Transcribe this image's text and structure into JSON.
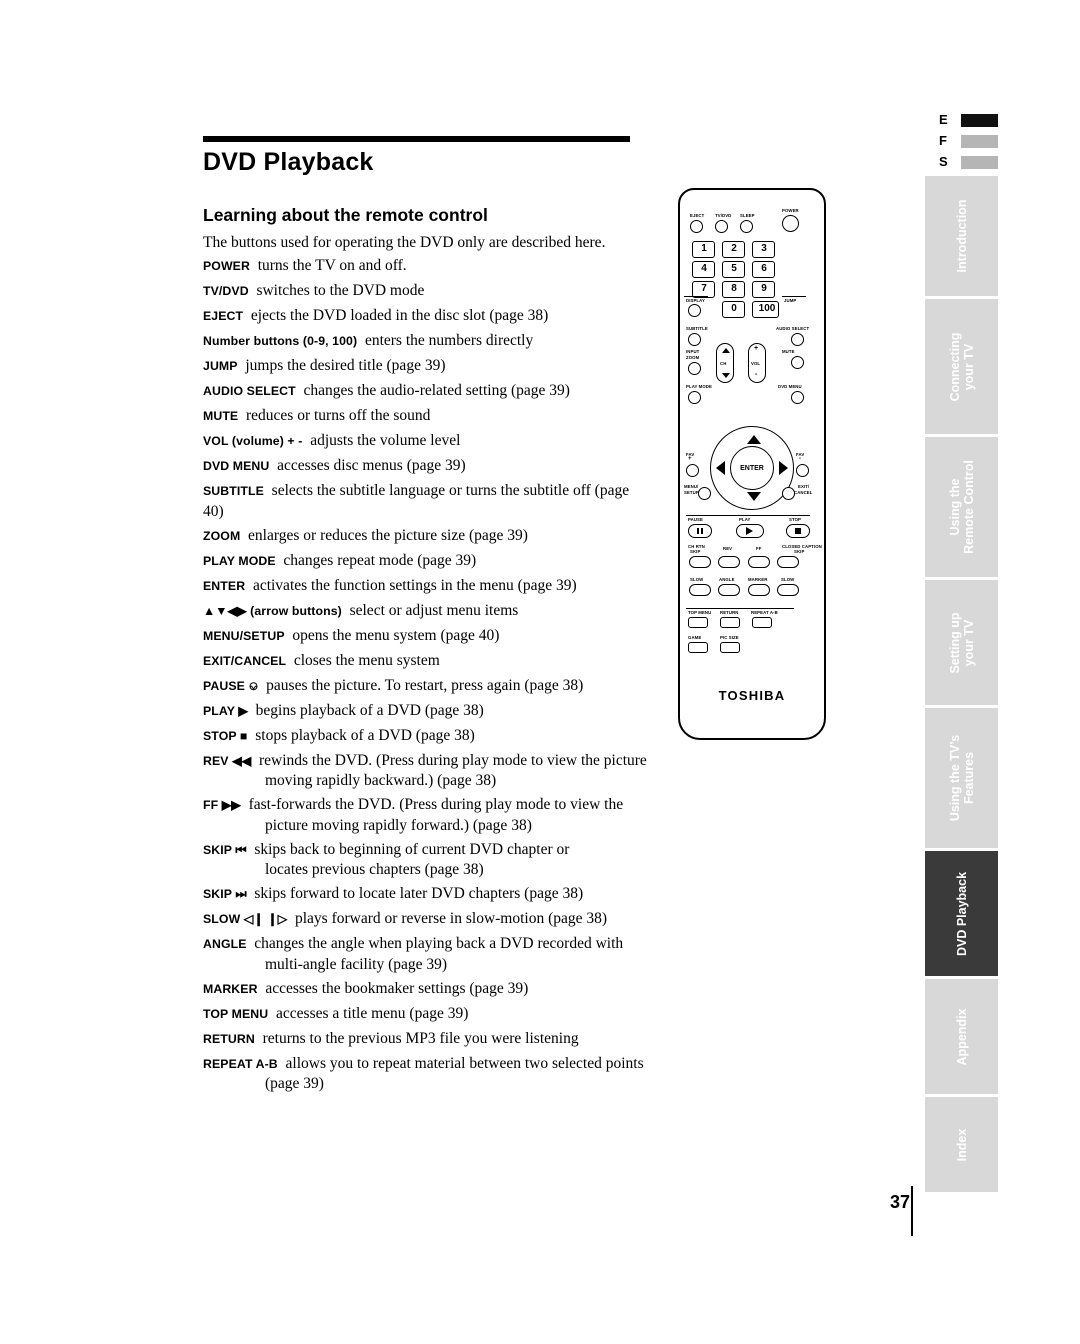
{
  "page": {
    "title": "DVD Playback",
    "section": "Learning about the remote control",
    "intro": "The buttons used for operating the DVD only are described here.",
    "number": "37"
  },
  "definitions": [
    {
      "key": "POWER",
      "text": "turns the TV on and off."
    },
    {
      "key": "TV/DVD",
      "text": "switches to the DVD mode"
    },
    {
      "key": "EJECT",
      "text": "ejects the DVD loaded in the disc slot (page 38)"
    },
    {
      "key": "Number buttons (0-9, 100)",
      "text": "enters the numbers directly",
      "keyonly": true
    },
    {
      "key": "JUMP",
      "text": "jumps the desired title (page 39)"
    },
    {
      "key": "AUDIO SELECT",
      "text": "changes the audio-related setting (page 39)"
    },
    {
      "key": "MUTE",
      "text": "reduces or turns off the sound"
    },
    {
      "key": "VOL (volume) + -",
      "text": "adjusts the volume level"
    },
    {
      "key": "DVD MENU",
      "text": "accesses disc menus (page 39)"
    },
    {
      "key": "SUBTITLE",
      "text": "selects the subtitle language or turns the subtitle off (page 40)"
    },
    {
      "key": "ZOOM",
      "text": "enlarges or reduces the picture size (page 39)"
    },
    {
      "key": "PLAY MODE",
      "text": "changes repeat mode (page 39)"
    },
    {
      "key": "ENTER",
      "text": "activates the function settings in the menu (page 39)"
    },
    {
      "key": "▲▼◀▶ (arrow buttons)",
      "text": "select or adjust menu items"
    },
    {
      "key": "MENU/SETUP",
      "text": "opens the menu system (page 40)"
    },
    {
      "key": "EXIT/CANCEL",
      "text": "closes the menu system"
    },
    {
      "key": "PAUSE ⎉",
      "text": "pauses the picture. To restart, press again (page 38)"
    },
    {
      "key": "PLAY ▶",
      "text": "begins playback of a DVD (page 38)"
    },
    {
      "key": "STOP ■",
      "text": "stops playback of a DVD (page 38)"
    },
    {
      "key": "REV ◀◀",
      "text": "rewinds the DVD. (Press during play mode to view the picture",
      "cont": "moving rapidly backward.) (page 38)"
    },
    {
      "key": "FF ▶▶",
      "text": "fast-forwards the DVD. (Press during play mode to view the",
      "cont": "picture moving rapidly forward.) (page 38)"
    },
    {
      "key": "SKIP ⏮",
      "text": "skips back to beginning of current DVD chapter or",
      "cont": "locates previous chapters (page 38)"
    },
    {
      "key": "SKIP ⏭",
      "text": "skips forward to locate later DVD chapters (page 38)"
    },
    {
      "key": "SLOW ◁❙ ❙▷",
      "text": "plays forward or reverse in slow-motion (page 38)"
    },
    {
      "key": "ANGLE",
      "text": "changes the angle when playing back a DVD recorded with",
      "cont": "multi-angle facility (page 39)"
    },
    {
      "key": "MARKER",
      "text": "accesses the bookmaker settings (page 39)"
    },
    {
      "key": "TOP MENU",
      "text": "accesses a title menu (page 39)"
    },
    {
      "key": "RETURN",
      "text": "returns to the previous MP3 file you were listening"
    },
    {
      "key": "REPEAT A-B",
      "text": "allows you to repeat material between two selected points",
      "cont": "(page 39)"
    }
  ],
  "remote": {
    "brand": "TOSHIBA",
    "labels": {
      "eject": "EJECT",
      "tvdvd": "TV/DVD",
      "sleep": "SLEEP",
      "power": "POWER",
      "display": "DISPLAY",
      "jump": "JUMP",
      "subtitle": "SUBTITLE",
      "audio_select": "AUDIO SELECT",
      "input": "INPUT",
      "zoom": "ZOOM",
      "ch": "CH",
      "vol": "VOL",
      "mute": "MUTE",
      "play_mode": "PLAY MODE",
      "dvd_menu": "DVD MENU",
      "fav_up": "FAV",
      "fav_down": "FAV",
      "enter": "ENTER",
      "menu_setup": "MENU/ SETUP",
      "exit_cancel": "EXIT/ CANCEL",
      "pause": "PAUSE",
      "play": "PLAY",
      "stop": "STOP",
      "ch_rtn_skip": "CH RTN SKIP",
      "rev": "REV",
      "ff": "FF",
      "closed_caption_skip": "CLOSED CAPTION SKIP",
      "slow_left": "SLOW",
      "angle": "ANGLE",
      "marker": "MARKER",
      "slow_right": "SLOW",
      "top_menu": "TOP MENU",
      "return": "RETURN",
      "repeat_ab": "REPEAT A-B",
      "game": "GAME",
      "pic_size": "PIC SIZE",
      "plus": "+",
      "minus": "-"
    },
    "numbers": [
      "1",
      "2",
      "3",
      "4",
      "5",
      "6",
      "7",
      "8",
      "9",
      "0",
      "100"
    ]
  },
  "sidetabs": {
    "efs": [
      "E",
      "F",
      "S"
    ],
    "items": [
      {
        "label": "Introduction",
        "active": false
      },
      {
        "label": "Connecting\nyour TV",
        "active": false
      },
      {
        "label": "Using the\nRemote Control",
        "active": false
      },
      {
        "label": "Setting up\nyour TV",
        "active": false
      },
      {
        "label": "Using the TV’s\nFeatures",
        "active": false
      },
      {
        "label": "DVD Playback",
        "active": true
      },
      {
        "label": "Appendix",
        "active": false
      },
      {
        "label": "Index",
        "active": false
      }
    ]
  }
}
